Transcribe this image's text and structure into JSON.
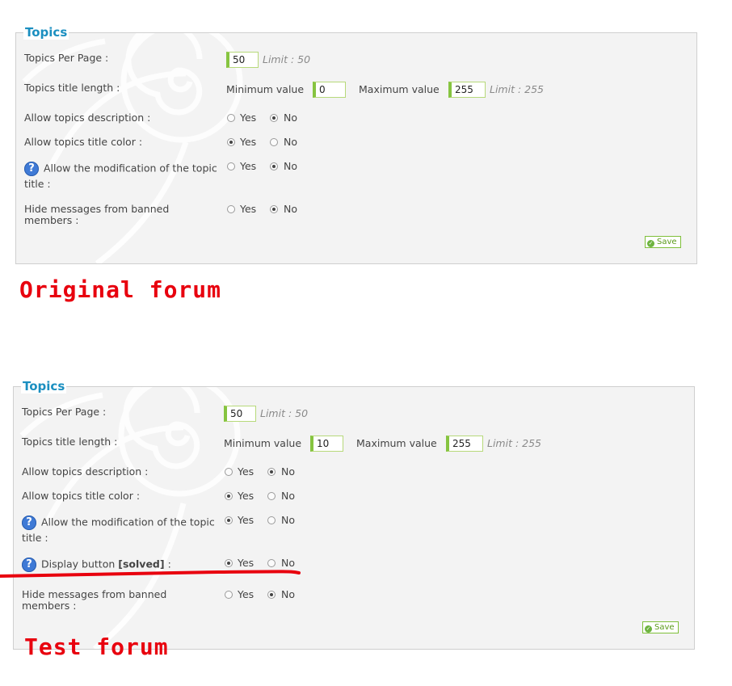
{
  "panels": [
    {
      "legend": "Topics",
      "per_page": {
        "label": "Topics Per Page :",
        "value": "50",
        "limit": "Limit : 50"
      },
      "title_length": {
        "label": "Topics title length :",
        "min_label": "Minimum value",
        "min_value": "0",
        "max_label": "Maximum value",
        "max_value": "255",
        "limit": "Limit : 255"
      },
      "description": {
        "label": "Allow topics description :",
        "yes": "Yes",
        "no": "No",
        "selected": "No"
      },
      "title_color": {
        "label": "Allow topics title color :",
        "yes": "Yes",
        "no": "No",
        "selected": "Yes"
      },
      "modification": {
        "label_line1": "Allow the modification of the topic",
        "label_line2": "title :",
        "yes": "Yes",
        "no": "No",
        "selected": "No"
      },
      "banned": {
        "label_line1": "Hide messages from banned",
        "label_line2": "members :",
        "yes": "Yes",
        "no": "No",
        "selected": "No"
      },
      "save": "Save",
      "caption": "Original forum"
    },
    {
      "legend": "Topics",
      "per_page": {
        "label": "Topics Per Page :",
        "value": "50",
        "limit": "Limit : 50"
      },
      "title_length": {
        "label": "Topics title length :",
        "min_label": "Minimum value",
        "min_value": "10",
        "max_label": "Maximum value",
        "max_value": "255",
        "limit": "Limit : 255"
      },
      "description": {
        "label": "Allow topics description :",
        "yes": "Yes",
        "no": "No",
        "selected": "No"
      },
      "title_color": {
        "label": "Allow topics title color :",
        "yes": "Yes",
        "no": "No",
        "selected": "Yes"
      },
      "modification": {
        "label_line1": "Allow the modification of the topic",
        "label_line2": "title :",
        "yes": "Yes",
        "no": "No",
        "selected": "Yes"
      },
      "solved": {
        "label_prefix": "Display button",
        "label_bold": "[solved]",
        "label_suffix": ":",
        "yes": "Yes",
        "no": "No",
        "selected": "Yes"
      },
      "banned": {
        "label_line1": "Hide messages from banned",
        "label_line2": "members :",
        "yes": "Yes",
        "no": "No",
        "selected": "No"
      },
      "save": "Save",
      "caption": "Test forum"
    }
  ],
  "icons": {
    "help": "help-question-icon",
    "save": "check-circle-icon"
  },
  "colors": {
    "accent": "#1b8fc0",
    "input_border": "#86c440",
    "caption": "#e8000e",
    "help": "#3f7ad6"
  }
}
